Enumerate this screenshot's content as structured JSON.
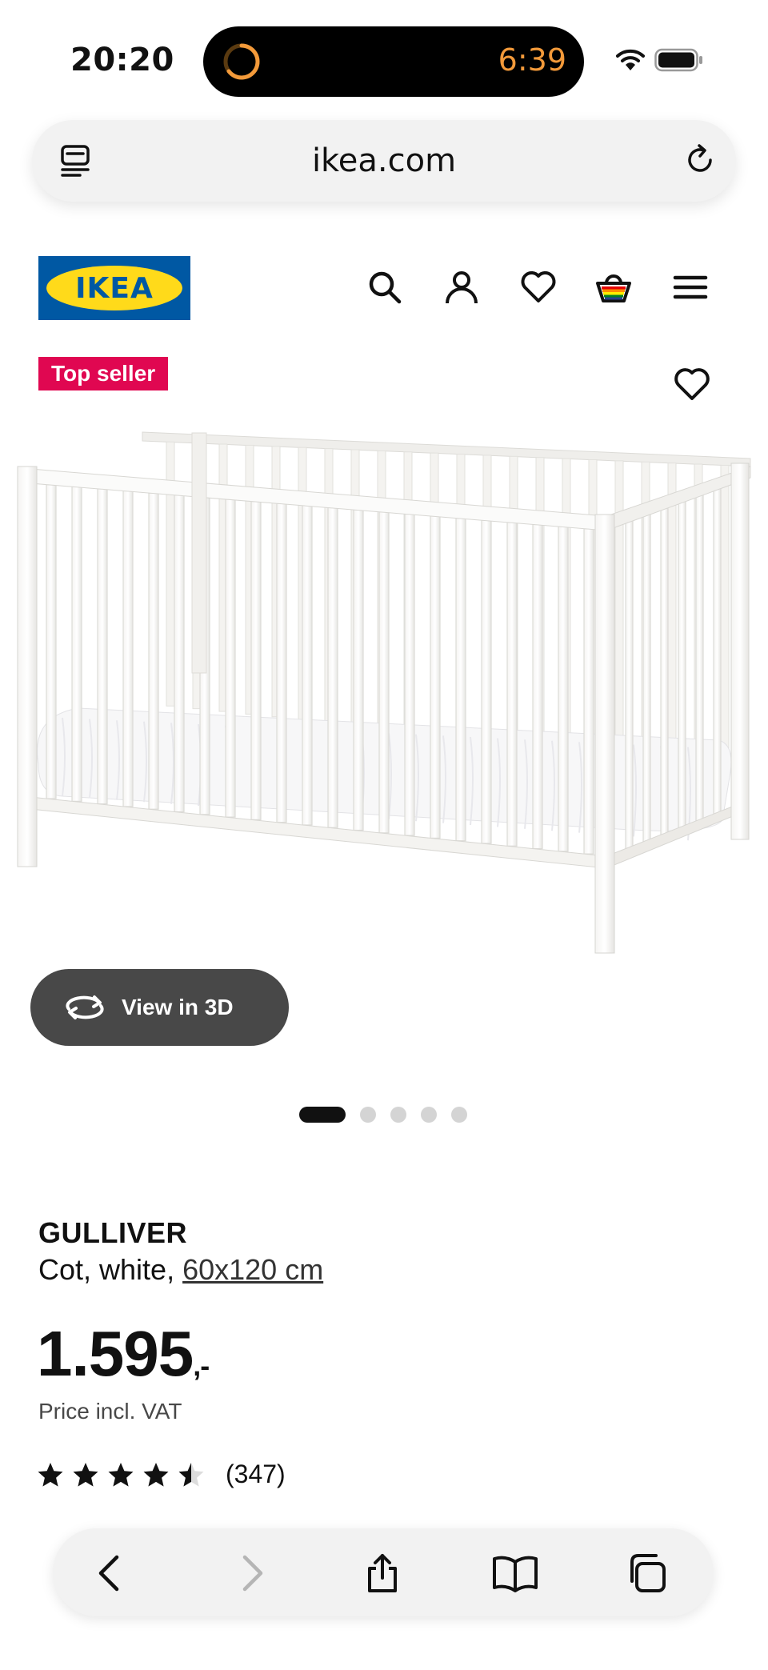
{
  "status_bar": {
    "time": "20:20",
    "island_timer": "6:39"
  },
  "browser": {
    "url": "ikea.com"
  },
  "header": {
    "logo_text": "IKEA"
  },
  "product": {
    "badge": "Top seller",
    "view_3d_label": "View in 3D",
    "carousel": {
      "total": 5,
      "active": 0
    },
    "name": "GULLIVER",
    "description_prefix": "Cot, white, ",
    "size": "60x120 cm",
    "price_main": "1.595",
    "price_suffix": ",-",
    "price_note": "Price incl. VAT",
    "rating": 4.5,
    "rating_max": 5,
    "review_count": "(347)"
  },
  "colors": {
    "brand_blue": "#0058a3",
    "brand_yellow": "#ffda1a",
    "badge_red": "#e00751",
    "timer_orange": "#f39a3a"
  }
}
